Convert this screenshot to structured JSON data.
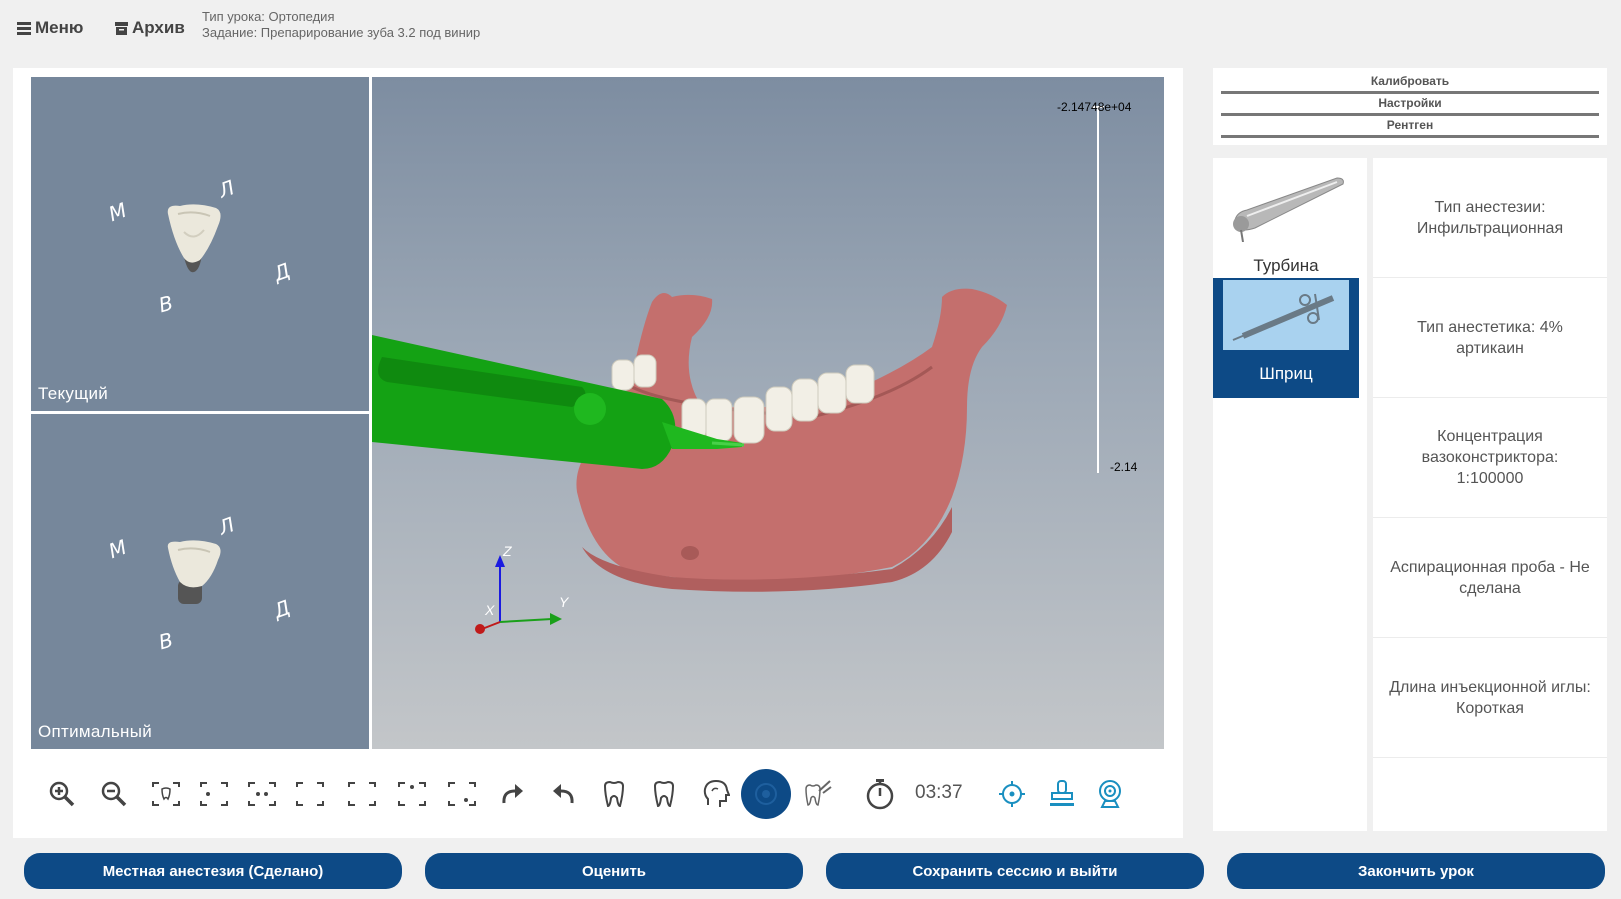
{
  "topbar": {
    "menu_label": "Меню",
    "archive_label": "Архив",
    "lesson_type": "Тип урока: Ортопедия",
    "task": "Задание: Препарирование зуба 3.2 под винир"
  },
  "views": {
    "current_label": "Текущий",
    "optimal_label": "Оптимальный",
    "directions": {
      "m": "М",
      "l": "Л",
      "d": "Д",
      "v": "В"
    }
  },
  "viewport": {
    "axis_z": "Z",
    "axis_x": "X",
    "axis_y": "Y",
    "scale_top": "-2.14748e+04",
    "scale_bottom": "-2.14"
  },
  "toolbar": {
    "timer": "03:37"
  },
  "right_panel": {
    "calibrate": "Калибровать",
    "settings": "Настройки",
    "xray": "Рентген"
  },
  "tools": [
    {
      "label": "Турбина",
      "selected": false
    },
    {
      "label": "Шприц",
      "selected": true
    }
  ],
  "info": [
    "Тип анестезии: Инфильтрационная",
    "Тип анестетика: 4% артикаин",
    "Концентрация вазоконстриктора: 1:100000",
    "Аспирационная проба - Не сделана",
    "Длина инъекционной иглы: Короткая"
  ],
  "bottom_buttons": {
    "anesthesia": "Местная анестезия (Сделано)",
    "evaluate": "Оценить",
    "save_exit": "Сохранить сессию и выйти",
    "finish": "Закончить урок"
  },
  "colors": {
    "primary": "#0d4a86",
    "accent_icon": "#1a8fc0",
    "viewport_small": "#76879b",
    "gum": "#c9706f",
    "syringe": "#1a9e1a"
  }
}
